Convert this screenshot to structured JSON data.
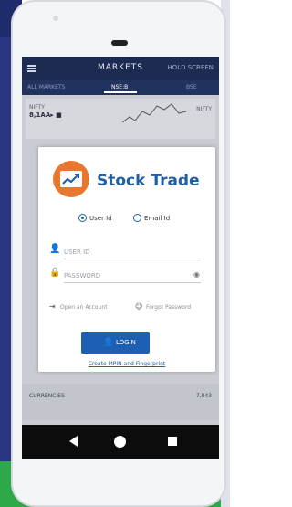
{
  "app": {
    "header_title": "MARKETS",
    "header_right": "HOLD SCREEN",
    "tabs": [
      {
        "label": "ALL MARKETS"
      },
      {
        "label": "NSE:B"
      },
      {
        "label": "BSE"
      }
    ]
  },
  "background": {
    "card_label": "NIFTY",
    "card_value": "8,1AA▸ ■",
    "card_right": "NIFTY",
    "bottom_left": "CURRENCIES",
    "bottom_right": "7,843"
  },
  "login": {
    "brand": "Stock Trade",
    "radio_user": "User Id",
    "radio_email": "Email Id",
    "user_placeholder": "USER ID",
    "password_placeholder": "PASSWORD",
    "open_account": "Open an Account",
    "forgot_password": "Forgot Password",
    "login_button": "LOGIN",
    "create_mpin": "Create MPIN and Fingerprint"
  },
  "colors": {
    "brand": "#1f5fa8",
    "login_button": "#1c5fb3",
    "logo": "#e8782f",
    "header": "#1d2b52"
  },
  "icons": {
    "user": "person-icon",
    "password": "lock-icon",
    "eye": "eye-icon",
    "open_account": "sign-in-icon",
    "forgot": "user-key-icon",
    "login": "person-icon"
  }
}
